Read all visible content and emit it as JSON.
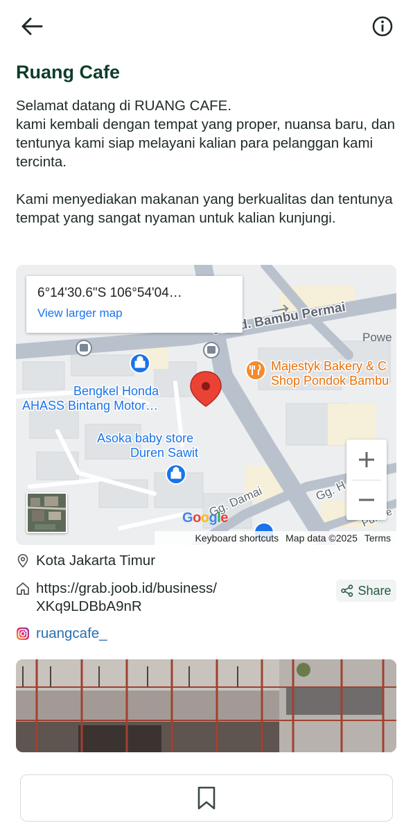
{
  "header": {
    "back_icon": "arrow-left-icon",
    "info_icon": "info-circle-icon"
  },
  "business": {
    "name": "Ruang Cafe",
    "description": "Selamat datang di RUANG CAFE.\nkami kembali dengan tempat yang proper, nuansa baru, dan tentunya kami siap melayani kalian para pelanggan kami tercinta.\n\nKami menyediakan makanan yang berkualitas dan tentunya tempat yang sangat nyaman untuk kalian kunjungi."
  },
  "map": {
    "coordinates": "6°14'30.6\"S 106°54'04…",
    "view_larger_label": "View larger map",
    "street_1": "Jl. Pd. Bambu Permai",
    "street_2": "Gg. Damai",
    "street_3": "Gg. H",
    "street_4": "Pd. Re",
    "place_powe": "Powe",
    "poi_bakery_1": "Majestyk Bakery & C",
    "poi_bakery_2": "Shop Pondok Bambu",
    "poi_honda_1": "Bengkel Honda",
    "poi_honda_2": "AHASS Bintang Motor…",
    "poi_asoka_1": "Asoka baby store",
    "poi_asoka_2": "Duren Sawit",
    "zoom_in": "+",
    "zoom_out": "−",
    "logo": "Google",
    "keyboard_shortcuts": "Keyboard shortcuts",
    "map_data": "Map data ©2025",
    "terms": "Terms"
  },
  "details": {
    "location": "Kota Jakarta Timur",
    "location_icon": "map-pin-icon",
    "website_line1": "https://grab.joob.id/business/",
    "website_line2": "XKq9LDBbA9nR",
    "website_icon": "home-icon",
    "instagram": "ruangcafe_",
    "instagram_icon": "instagram-icon"
  },
  "share": {
    "label": "Share",
    "icon": "share-icon"
  },
  "bottom": {
    "icon": "bookmark-icon"
  },
  "colors": {
    "title": "#0f3d2a",
    "accent": "#225a3e",
    "link": "#1a73e8",
    "map_pin": "#e53935"
  }
}
